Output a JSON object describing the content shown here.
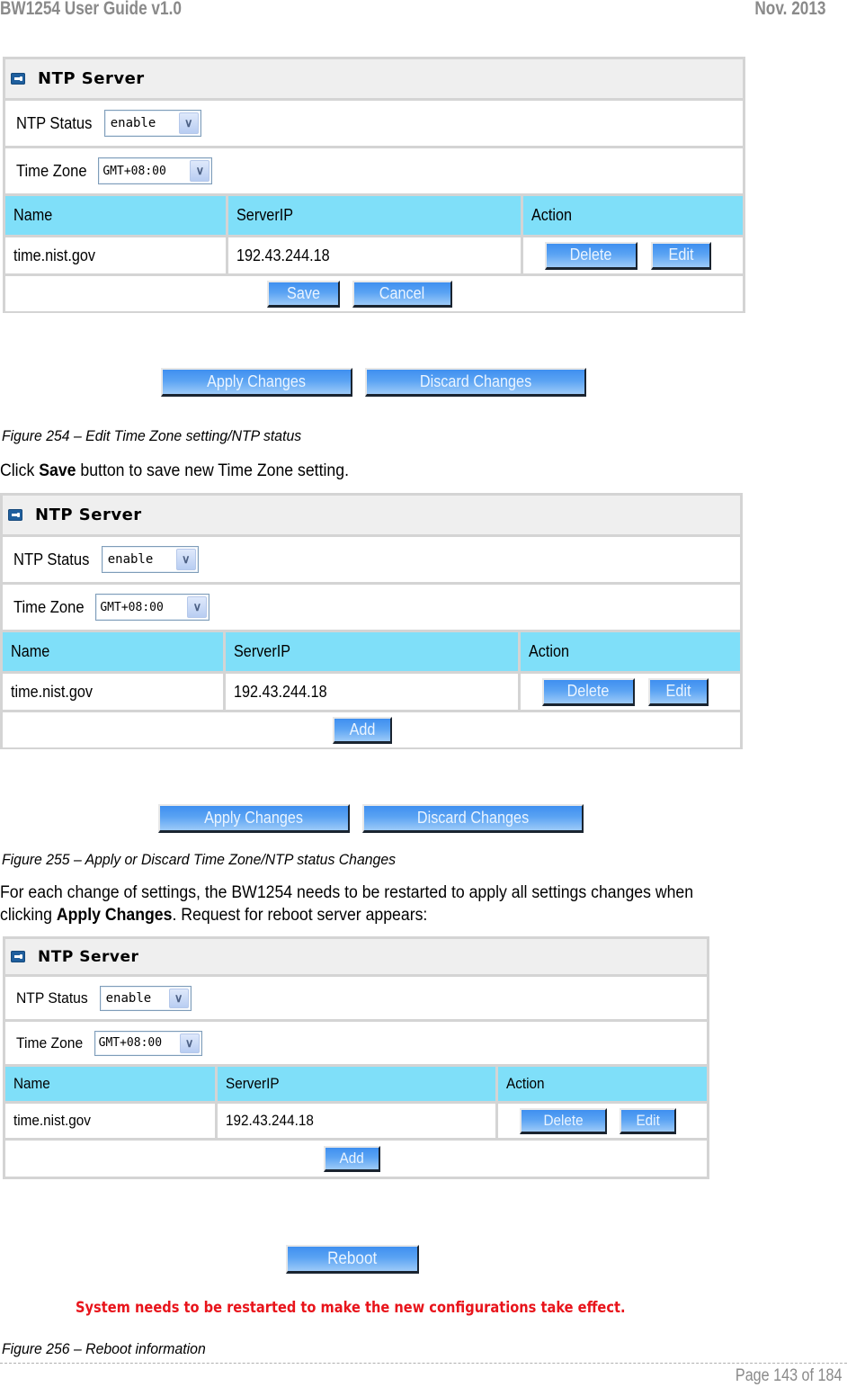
{
  "header": {
    "title": "BW1254 User Guide v1.0",
    "date": "Nov.  2013"
  },
  "figures": [
    {
      "panel": {
        "title": "NTP Server",
        "ntp_status_label": "NTP Status",
        "ntp_status_value": "enable",
        "time_zone_label": "Time Zone",
        "time_zone_value": "GMT+08:00",
        "columns": [
          "Name",
          "ServerIP",
          "Action"
        ],
        "rows": [
          {
            "name": "time.nist.gov",
            "server_ip": "192.43.244.18",
            "delete_label": "Delete",
            "edit_label": "Edit"
          }
        ],
        "footer_buttons": [
          "Save",
          "Cancel"
        ]
      },
      "apply_label": "Apply Changes",
      "discard_label": "Discard Changes",
      "caption": "Figure 254 – Edit Time Zone setting/NTP status"
    },
    {
      "panel": {
        "title": "NTP Server",
        "ntp_status_label": "NTP Status",
        "ntp_status_value": "enable",
        "time_zone_label": "Time Zone",
        "time_zone_value": "GMT+08:00",
        "columns": [
          "Name",
          "ServerIP",
          "Action"
        ],
        "rows": [
          {
            "name": "time.nist.gov",
            "server_ip": "192.43.244.18",
            "delete_label": "Delete",
            "edit_label": "Edit"
          }
        ],
        "footer_buttons": [
          "Add"
        ]
      },
      "apply_label": "Apply Changes",
      "discard_label": "Discard Changes",
      "caption": "Figure 255 – Apply or Discard Time Zone/NTP status Changes"
    },
    {
      "panel": {
        "title": "NTP Server",
        "ntp_status_label": "NTP Status",
        "ntp_status_value": "enable",
        "time_zone_label": "Time Zone",
        "time_zone_value": "GMT+08:00",
        "columns": [
          "Name",
          "ServerIP",
          "Action"
        ],
        "rows": [
          {
            "name": "time.nist.gov",
            "server_ip": "192.43.244.18",
            "delete_label": "Delete",
            "edit_label": "Edit"
          }
        ],
        "footer_buttons": [
          "Add"
        ]
      },
      "reboot_label": "Reboot",
      "warning": "System needs to be restarted to make the new configurations take effect.",
      "caption": "Figure 256 – Reboot information"
    }
  ],
  "paragraphs": {
    "p1_prefix": "Click ",
    "p1_bold": "Save",
    "p1_suffix": " button to save new Time Zone setting.",
    "p2_line1": "For each change of settings, the BW1254 needs to be restarted to apply all settings changes when",
    "p2_prefix": "clicking ",
    "p2_bold": "Apply Changes",
    "p2_suffix": ". Request for reboot server appears:"
  },
  "footer": {
    "page": "Page 143 of 184"
  },
  "colors": {
    "table_header": "#7fdff9",
    "button_blue": "#4a9af2",
    "warning_red": "#e8141b",
    "panel_border": "#d4d4d4"
  }
}
